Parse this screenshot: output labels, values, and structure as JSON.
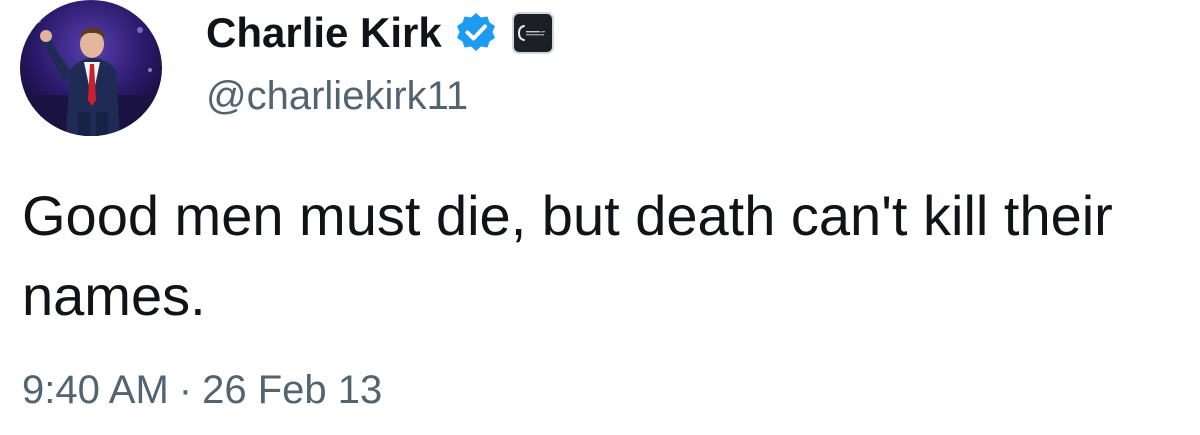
{
  "author": {
    "display_name": "Charlie Kirk",
    "handle": "@charliekirk11",
    "verified": true,
    "verified_color": "#1d9bf0",
    "avatar_icon": "profile-photo",
    "affiliate_badge_icon": "organization-badge-icon"
  },
  "tweet": {
    "text": "Good men must die, but death can't kill their names.",
    "time": "9:40 AM",
    "separator": "·",
    "date": "26 Feb 13"
  },
  "colors": {
    "text_primary": "#0f1419",
    "text_secondary": "#536471",
    "background": "#ffffff"
  }
}
